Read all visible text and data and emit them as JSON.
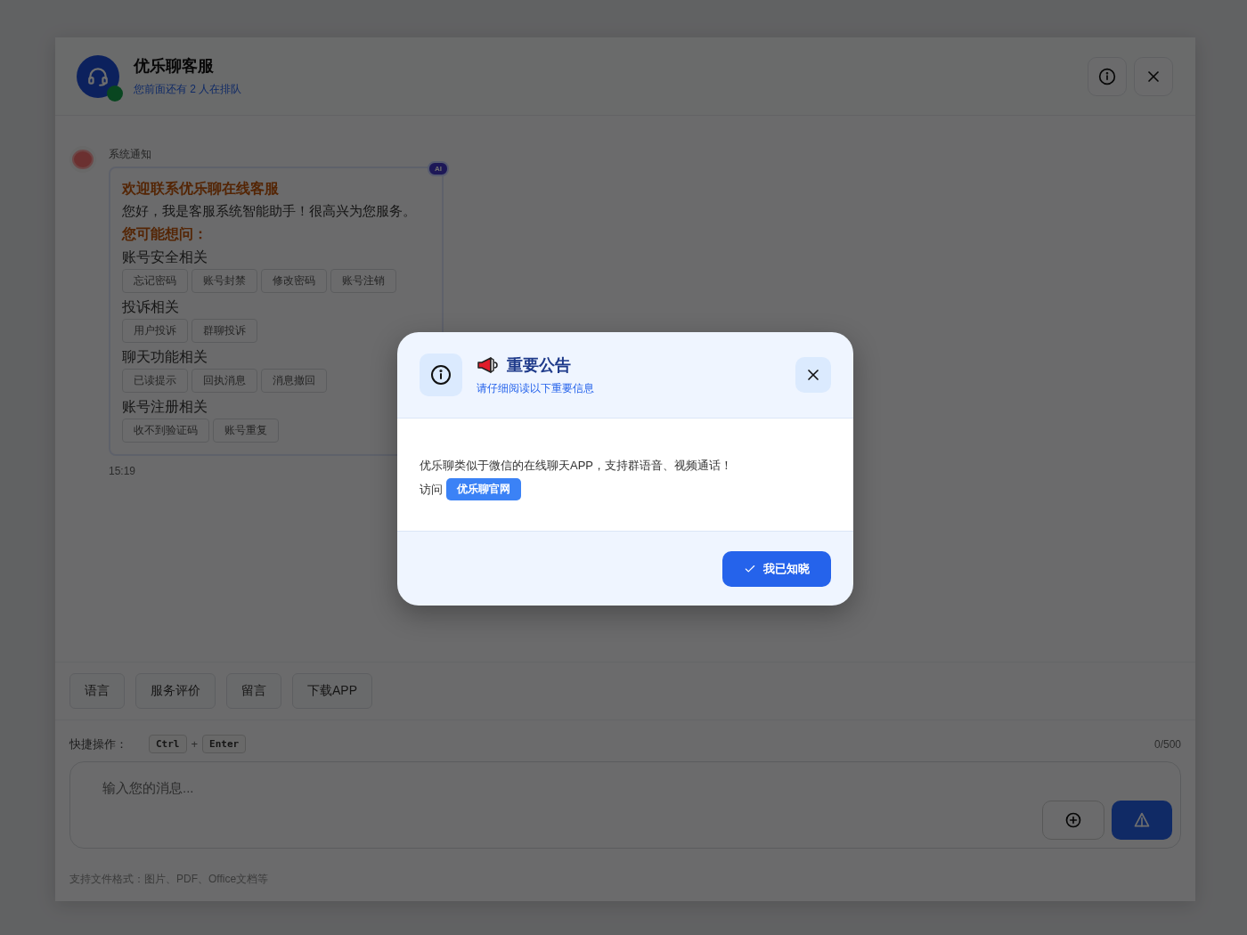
{
  "header": {
    "title": "优乐聊客服",
    "queue_status": "您前面还有 2 人在排队"
  },
  "messages": [
    {
      "sender": "系统通知",
      "badge": "AI",
      "title": "欢迎联系优乐聊在线客服",
      "greeting": "您好，我是客服系统智能助手！很高兴为您服务。",
      "prompt": "您可能想问：",
      "groups": [
        {
          "heading": "账号安全相关",
          "options": [
            "忘记密码",
            "账号封禁",
            "修改密码",
            "账号注销"
          ]
        },
        {
          "heading": "投诉相关",
          "options": [
            "用户投诉",
            "群聊投诉"
          ]
        },
        {
          "heading": "聊天功能相关",
          "options": [
            "已读提示",
            "回执消息",
            "消息撤回"
          ]
        },
        {
          "heading": "账号注册相关",
          "options": [
            "收不到验证码",
            "账号重复"
          ]
        }
      ],
      "time": "15:19"
    }
  ],
  "quick_actions": [
    "语言",
    "服务评价",
    "留言",
    "下载APP"
  ],
  "shortcut": {
    "label": "快捷操作：",
    "keys": [
      "Ctrl",
      "Enter"
    ],
    "separator": "+"
  },
  "counter": "0/500",
  "input": {
    "placeholder": "输入您的消息..."
  },
  "hint": "支持文件格式：图片、PDF、Office文档等",
  "dialog": {
    "title": "重要公告",
    "subtitle": "请仔细阅读以下重要信息",
    "body": "优乐聊类似于微信的在线聊天APP，支持群语音、视频通话！",
    "link_prefix": "访问",
    "link": "优乐聊官网",
    "confirm": "我已知晓"
  }
}
